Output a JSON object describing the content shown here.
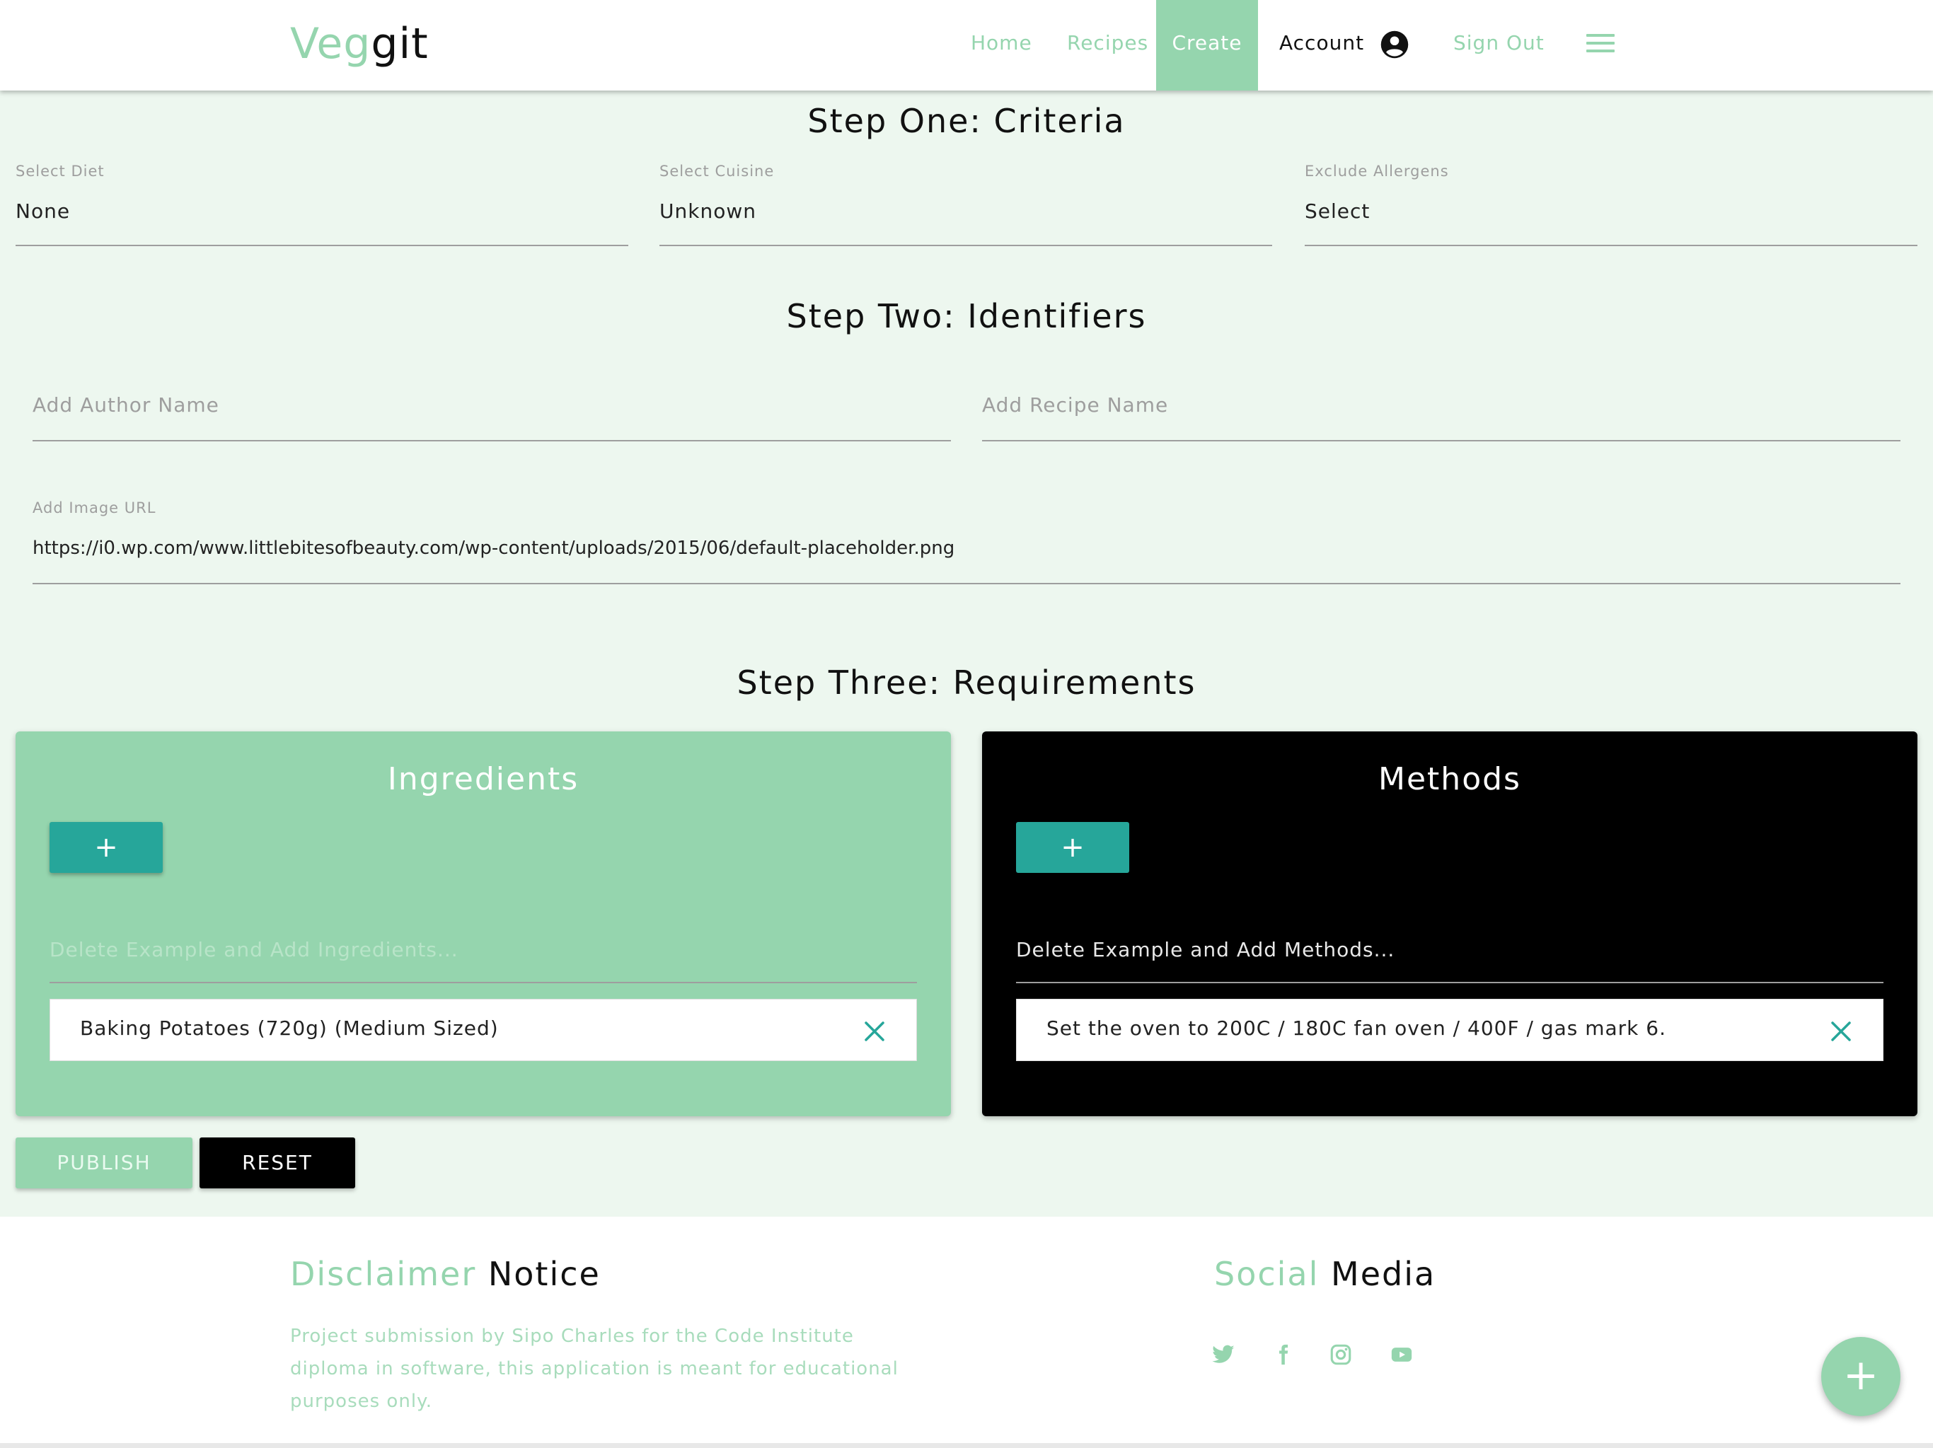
{
  "brand": {
    "part1": "Veg",
    "part2": "git"
  },
  "nav": {
    "home": "Home",
    "recipes": "Recipes",
    "create": "Create",
    "account": "Account",
    "sign_out": "Sign Out"
  },
  "step_one": {
    "heading": "Step One: Criteria",
    "diet": {
      "label": "Select Diet",
      "value": "None"
    },
    "cuisine": {
      "label": "Select Cuisine",
      "value": "Unknown"
    },
    "allergens": {
      "label": "Exclude Allergens",
      "value": "Select"
    }
  },
  "step_two": {
    "heading": "Step Two: Identifiers",
    "author_placeholder": "Add Author Name",
    "recipe_placeholder": "Add Recipe Name",
    "image_url": {
      "label": "Add Image URL",
      "value": "https://i0.wp.com/www.littlebitesofbeauty.com/wp-content/uploads/2015/06/default-placeholder.png"
    }
  },
  "step_three": {
    "heading": "Step Three: Requirements",
    "ingredients": {
      "title": "Ingredients",
      "add_label": "+",
      "placeholder": "Delete Example and Add Ingredients...",
      "items": [
        "Baking Potatoes (720g) (Medium Sized)"
      ]
    },
    "methods": {
      "title": "Methods",
      "add_label": "+",
      "placeholder": "Delete Example and Add Methods...",
      "items": [
        "Set the oven to 200C / 180C fan oven / 400F / gas mark 6."
      ]
    }
  },
  "actions": {
    "publish": "PUBLISH",
    "reset": "RESET"
  },
  "footer": {
    "disclaimer": {
      "heading_accent": "Disclaimer",
      "heading_dark": "Notice",
      "text": "Project submission by Sipo Charles for the Code Institute diploma in software, this application is meant for educational purposes only."
    },
    "social": {
      "heading_accent": "Social",
      "heading_dark": "Media",
      "icons": [
        "twitter-icon",
        "facebook-icon",
        "instagram-icon",
        "youtube-icon"
      ]
    }
  },
  "fab_label": "+",
  "colors": {
    "accent": "#95d5ae",
    "teal": "#26a69a",
    "dark": "#000000",
    "page_bg": "#edf7ef"
  }
}
